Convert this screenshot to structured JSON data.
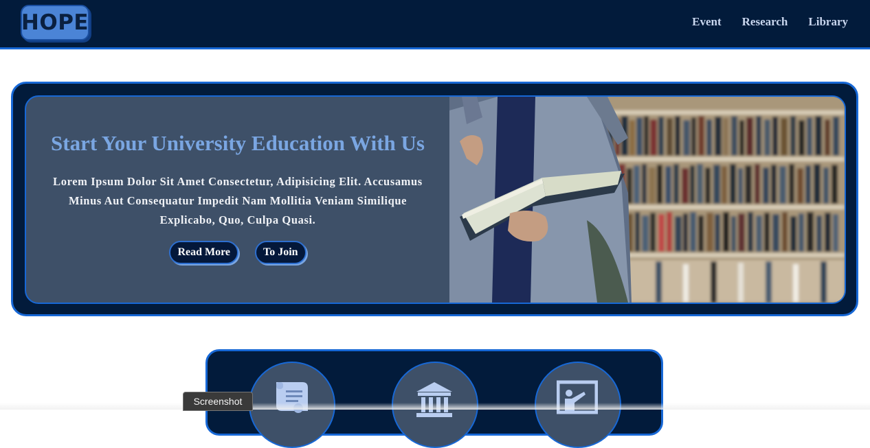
{
  "brand": {
    "logo_text": "HOPE"
  },
  "nav": {
    "links": [
      {
        "label": "Event"
      },
      {
        "label": "Research"
      },
      {
        "label": "Library"
      }
    ]
  },
  "hero": {
    "title": "Start Your University Education With Us",
    "description": "Lorem Ipsum Dolor Sit Amet Consectetur, Adipisicing Elit. Accusamus Minus Aut Consequatur Impedit Nam Mollitia Veniam Similique Explicabo, Quo, Culpa Quasi.",
    "buttons": {
      "read_more": "Read More",
      "join": "To Join"
    },
    "image": "student-reading-book-in-library"
  },
  "services": {
    "icons": [
      "scroll-icon",
      "institution-icon",
      "teacher-board-icon"
    ]
  },
  "overlay": {
    "screenshot_label": "Screenshot"
  },
  "colors": {
    "nav_bg": "#021b3b",
    "accent": "#1768d6",
    "panel": "#3e5068",
    "title": "#7aa6e2",
    "logo": "#4b84d6"
  }
}
